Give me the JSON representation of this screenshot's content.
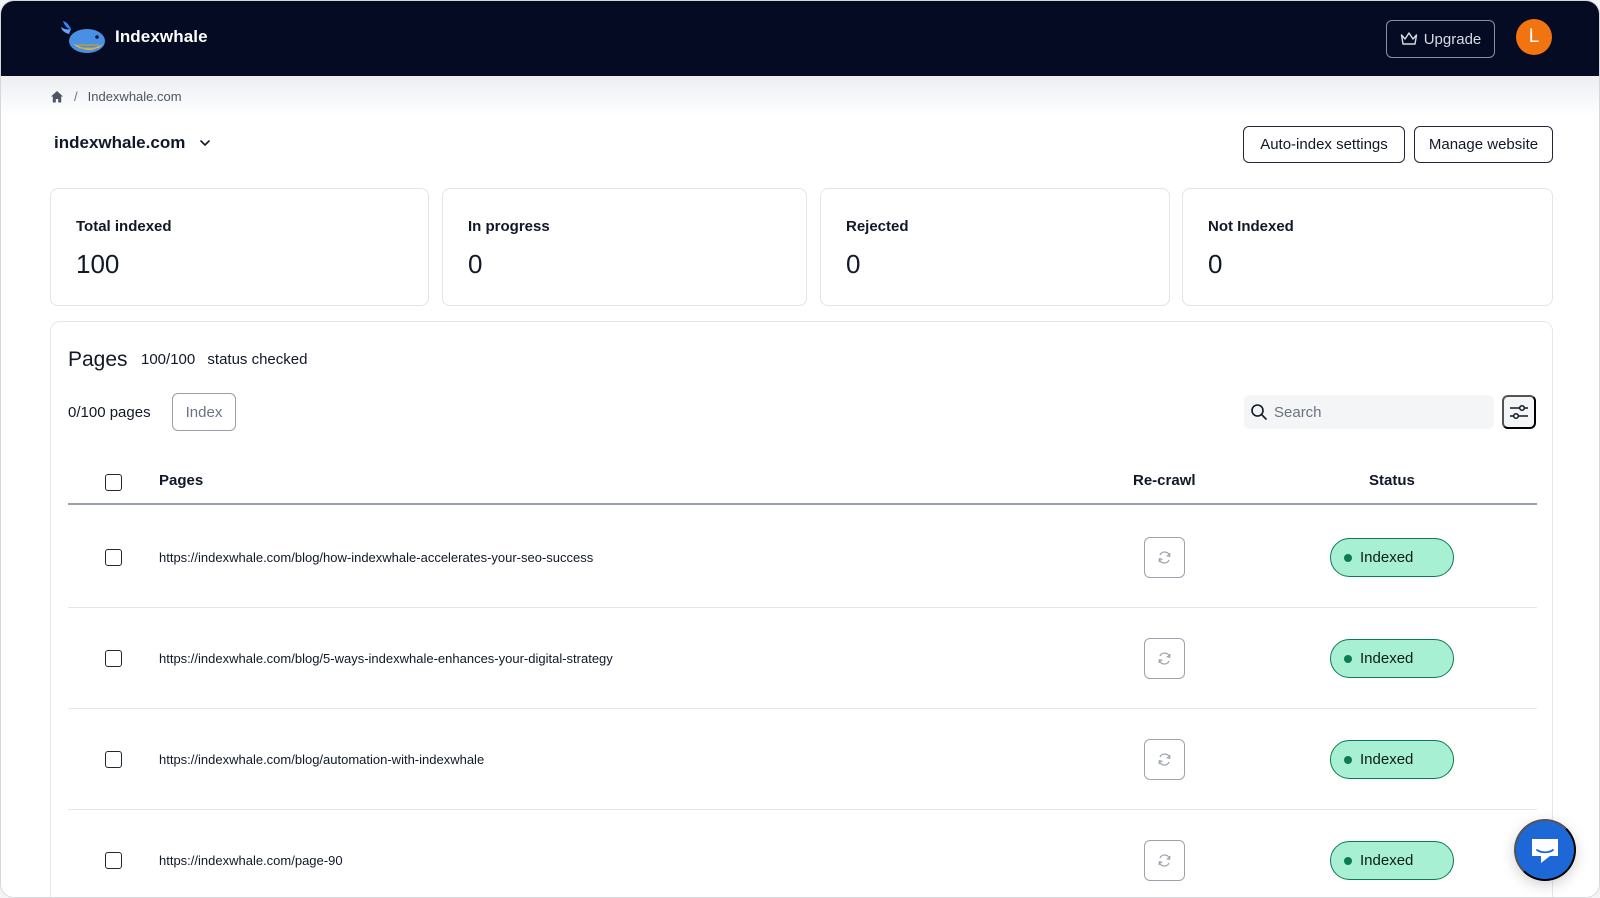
{
  "app": {
    "name": "Indexwhale"
  },
  "header": {
    "upgrade_label": "Upgrade",
    "avatar_initial": "L",
    "avatar_color": "#f27411"
  },
  "breadcrumb": {
    "current": "Indexwhale.com"
  },
  "site": {
    "name": "indexwhale.com",
    "auto_index_label": "Auto-index settings",
    "manage_label": "Manage website"
  },
  "stats": [
    {
      "label": "Total indexed",
      "value": "100"
    },
    {
      "label": "In progress",
      "value": "0"
    },
    {
      "label": "Rejected",
      "value": "0"
    },
    {
      "label": "Not Indexed",
      "value": "0"
    }
  ],
  "pages_panel": {
    "title": "Pages",
    "checked_count": "100/100",
    "checked_label": "status checked",
    "selection": "0/100 pages",
    "index_label": "Index",
    "search_placeholder": "Search",
    "columns": {
      "pages": "Pages",
      "recrawl": "Re-crawl",
      "status": "Status"
    },
    "rows": [
      {
        "url": "https://indexwhale.com/blog/how-indexwhale-accelerates-your-seo-success",
        "status": "Indexed"
      },
      {
        "url": "https://indexwhale.com/blog/5-ways-indexwhale-enhances-your-digital-strategy",
        "status": "Indexed"
      },
      {
        "url": "https://indexwhale.com/blog/automation-with-indexwhale",
        "status": "Indexed"
      },
      {
        "url": "https://indexwhale.com/page-90",
        "status": "Indexed"
      }
    ]
  },
  "colors": {
    "topbar": "#050b22",
    "status_indexed_bg": "#a7f0d3",
    "status_indexed_border": "#0c7a52",
    "chat": "#1d67d6"
  }
}
